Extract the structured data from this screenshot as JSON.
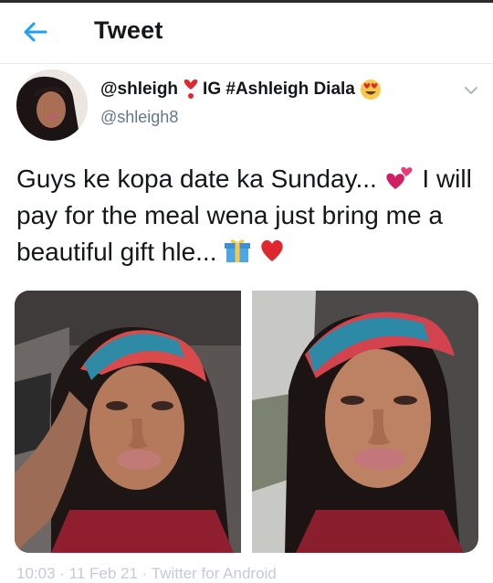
{
  "header": {
    "title": "Tweet",
    "back_icon": "arrow-left-icon",
    "accent_color": "#1da1f2"
  },
  "tweet": {
    "display_name_prefix": "@shleigh",
    "display_name_suffix": "IG #Ashleigh Diala",
    "handle": "@shleigh8",
    "name_emojis": [
      "red-heart-exclamation-icon",
      "heart-eyes-face-icon"
    ],
    "text_line1": "Guys ke kopa date ka Sunday...",
    "text_line2": "I will pay for the meal wena just bring me a beautiful gift hle...",
    "text_emojis": [
      "two-hearts-icon",
      "gift-icon",
      "red-heart-icon"
    ],
    "media_count": 2,
    "footer_partial": "10:03 · 11 Feb 21 · Twitter for Android"
  }
}
